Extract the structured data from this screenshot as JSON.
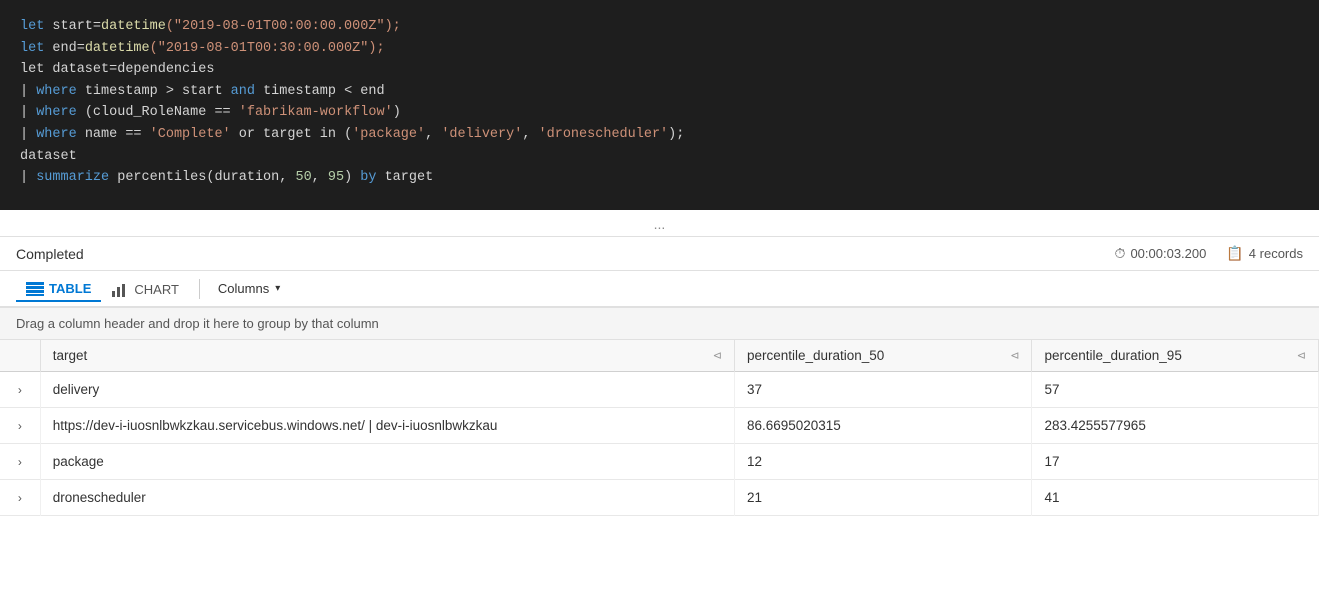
{
  "code": {
    "lines": [
      {
        "type": "mixed",
        "parts": [
          {
            "text": "let ",
            "cls": "kw"
          },
          {
            "text": "start=",
            "cls": "plain"
          },
          {
            "text": "datetime",
            "cls": "fn"
          },
          {
            "text": "(\"2019-08-01T00:00:00.000Z\");",
            "cls": "str"
          }
        ]
      },
      {
        "type": "mixed",
        "parts": [
          {
            "text": "let ",
            "cls": "kw"
          },
          {
            "text": "end=",
            "cls": "plain"
          },
          {
            "text": "datetime",
            "cls": "fn"
          },
          {
            "text": "(\"2019-08-01T00:30:00.000Z\");",
            "cls": "str"
          }
        ]
      },
      {
        "type": "mixed",
        "parts": [
          {
            "text": "let dataset=dependencies",
            "cls": "plain"
          }
        ]
      },
      {
        "type": "mixed",
        "parts": [
          {
            "text": "| ",
            "cls": "pipe"
          },
          {
            "text": "where",
            "cls": "kw"
          },
          {
            "text": " timestamp > start ",
            "cls": "plain"
          },
          {
            "text": "and",
            "cls": "op"
          },
          {
            "text": " timestamp < end",
            "cls": "plain"
          }
        ]
      },
      {
        "type": "mixed",
        "parts": [
          {
            "text": "| ",
            "cls": "pipe"
          },
          {
            "text": "where",
            "cls": "kw"
          },
          {
            "text": " (cloud_RoleName == ",
            "cls": "plain"
          },
          {
            "text": "'fabrikam-workflow'",
            "cls": "str"
          },
          {
            "text": ")",
            "cls": "plain"
          }
        ]
      },
      {
        "type": "mixed",
        "parts": [
          {
            "text": "| ",
            "cls": "pipe"
          },
          {
            "text": "where",
            "cls": "kw"
          },
          {
            "text": " name == ",
            "cls": "plain"
          },
          {
            "text": "'Complete'",
            "cls": "str"
          },
          {
            "text": " or target in (",
            "cls": "plain"
          },
          {
            "text": "'package'",
            "cls": "str"
          },
          {
            "text": ", ",
            "cls": "plain"
          },
          {
            "text": "'delivery'",
            "cls": "str"
          },
          {
            "text": ", ",
            "cls": "plain"
          },
          {
            "text": "'dronescheduler'",
            "cls": "str"
          },
          {
            "text": ");",
            "cls": "plain"
          }
        ]
      },
      {
        "type": "mixed",
        "parts": [
          {
            "text": "dataset",
            "cls": "plain"
          }
        ]
      },
      {
        "type": "mixed",
        "parts": [
          {
            "text": "| ",
            "cls": "pipe"
          },
          {
            "text": "summarize",
            "cls": "kw"
          },
          {
            "text": " percentiles(duration, ",
            "cls": "plain"
          },
          {
            "text": "50",
            "cls": "num"
          },
          {
            "text": ", ",
            "cls": "plain"
          },
          {
            "text": "95",
            "cls": "num"
          },
          {
            "text": ") ",
            "cls": "plain"
          },
          {
            "text": "by",
            "cls": "op"
          },
          {
            "text": " target",
            "cls": "plain"
          }
        ]
      }
    ]
  },
  "ellipsis": "...",
  "results": {
    "status": "Completed",
    "duration": "00:00:03.200",
    "records": "4 records"
  },
  "toolbar": {
    "table_label": "TABLE",
    "chart_label": "CHART",
    "columns_label": "Columns"
  },
  "group_hint": "Drag a column header and drop it here to group by that column",
  "columns": [
    {
      "key": "target",
      "label": "target"
    },
    {
      "key": "percentile_duration_50",
      "label": "percentile_duration_50"
    },
    {
      "key": "percentile_duration_95",
      "label": "percentile_duration_95"
    }
  ],
  "rows": [
    {
      "target": "delivery",
      "p50": "37",
      "p95": "57"
    },
    {
      "target": "https://dev-i-iuosnlbwkzkau.servicebus.windows.net/ | dev-i-iuosnlbwkzkau",
      "p50": "86.6695020315",
      "p95": "283.4255577965"
    },
    {
      "target": "package",
      "p50": "12",
      "p95": "17"
    },
    {
      "target": "dronescheduler",
      "p50": "21",
      "p95": "41"
    }
  ]
}
